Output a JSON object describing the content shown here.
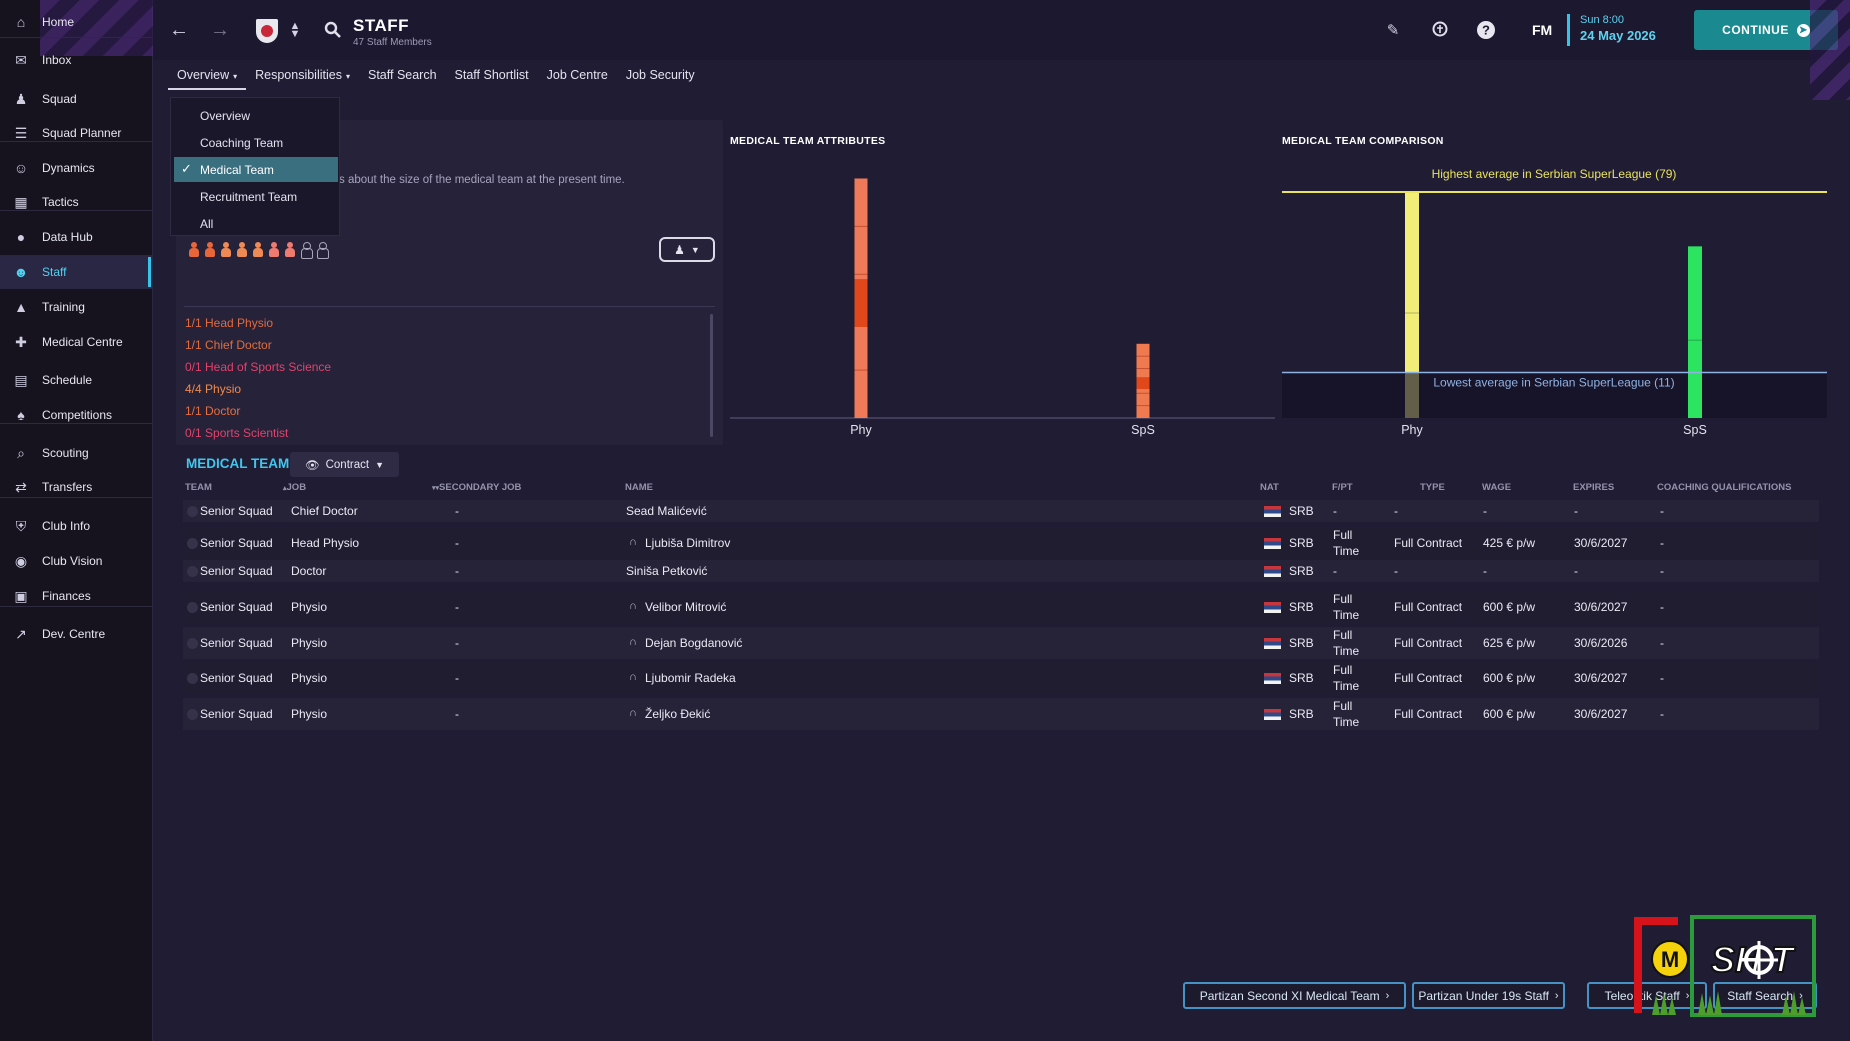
{
  "sidebar": {
    "items": [
      {
        "label": "Home",
        "icon": "home-icon"
      },
      {
        "label": "Inbox",
        "icon": "inbox-icon"
      },
      {
        "label": "Squad",
        "icon": "squad-icon"
      },
      {
        "label": "Squad Planner",
        "icon": "planner-icon"
      },
      {
        "label": "Dynamics",
        "icon": "dynamics-icon"
      },
      {
        "label": "Tactics",
        "icon": "tactics-icon"
      },
      {
        "label": "Data Hub",
        "icon": "data-hub-icon"
      },
      {
        "label": "Staff",
        "icon": "staff-icon"
      },
      {
        "label": "Training",
        "icon": "training-icon"
      },
      {
        "label": "Medical Centre",
        "icon": "medical-icon"
      },
      {
        "label": "Schedule",
        "icon": "calendar-icon"
      },
      {
        "label": "Competitions",
        "icon": "trophy-icon"
      },
      {
        "label": "Scouting",
        "icon": "scouting-icon"
      },
      {
        "label": "Transfers",
        "icon": "transfers-icon"
      },
      {
        "label": "Club Info",
        "icon": "shield-icon"
      },
      {
        "label": "Club Vision",
        "icon": "vision-icon"
      },
      {
        "label": "Finances",
        "icon": "finances-icon"
      },
      {
        "label": "Dev. Centre",
        "icon": "dev-centre-icon"
      }
    ],
    "active": "Staff"
  },
  "header": {
    "title": "STAFF",
    "subtitle": "47 Staff Members",
    "fm_label": "FM",
    "date_line1": "Sun 8:00",
    "date_line2": "24 May 2026",
    "continue_label": "CONTINUE"
  },
  "tabs": [
    {
      "label": "Overview",
      "dropdown": true,
      "active": true
    },
    {
      "label": "Responsibilities",
      "dropdown": true,
      "active": false
    },
    {
      "label": "Staff Search",
      "dropdown": false,
      "active": false
    },
    {
      "label": "Staff Shortlist",
      "dropdown": false,
      "active": false
    },
    {
      "label": "Job Centre",
      "dropdown": false,
      "active": false
    },
    {
      "label": "Job Security",
      "dropdown": false,
      "active": false
    }
  ],
  "dropdown": {
    "items": [
      "Overview",
      "Coaching Team",
      "Medical Team",
      "Recruitment Team",
      "All"
    ],
    "selected": "Medical Team"
  },
  "left_panel": {
    "description": "s about the size of the medical team at the present time.",
    "staff_icons": [
      {
        "filled": true,
        "color": "#e8673a"
      },
      {
        "filled": true,
        "color": "#e8673a"
      },
      {
        "filled": true,
        "color": "#ef8a55"
      },
      {
        "filled": true,
        "color": "#ef8a55"
      },
      {
        "filled": true,
        "color": "#ef8a55"
      },
      {
        "filled": true,
        "color": "#ef7a70"
      },
      {
        "filled": true,
        "color": "#ef7a70"
      },
      {
        "filled": false,
        "color": "#a8a6ba"
      },
      {
        "filled": false,
        "color": "#a8a6ba"
      }
    ],
    "requirements": [
      {
        "text": "1/1 Head Physio",
        "color": "#e36a3a"
      },
      {
        "text": "1/1 Chief Doctor",
        "color": "#e06e3c"
      },
      {
        "text": "0/1 Head of Sports Science",
        "color": "#e2436a"
      },
      {
        "text": "4/4 Physio",
        "color": "#f08a4a"
      },
      {
        "text": "1/1 Doctor",
        "color": "#e86e3c"
      },
      {
        "text": "0/1 Sports Scientist",
        "color": "#e2436a"
      }
    ]
  },
  "chart_data": [
    {
      "type": "bar",
      "title": "MEDICAL TEAM ATTRIBUTES",
      "categories": [
        "Phy",
        "SpS"
      ],
      "values": [
        71,
        22
      ],
      "segment_count": [
        5,
        6
      ],
      "colors": [
        "#ef7a5a",
        "#f07a50"
      ]
    },
    {
      "type": "bar",
      "title": "MEDICAL TEAM COMPARISON",
      "categories": [
        "Phy",
        "SpS"
      ],
      "values": [
        79,
        60
      ],
      "colors": [
        "#f2ec79",
        "#2ce460"
      ],
      "reference_lines": [
        {
          "label": "Highest average in Serbian SuperLeague (79)",
          "value": 79,
          "color": "#eae35c"
        },
        {
          "label": "Lowest average in Serbian SuperLeague (11)",
          "value": 11,
          "color": "#8fb2e3"
        }
      ]
    }
  ],
  "table": {
    "section_title": "MEDICAL TEAM",
    "contract_button": "Contract",
    "columns": [
      "TEAM",
      "JOB",
      "SECONDARY JOB",
      "NAME",
      "NAT",
      "F/PT",
      "TYPE",
      "WAGE",
      "EXPIRES",
      "COACHING QUALIFICATIONS"
    ],
    "rows": [
      {
        "team": "Senior Squad",
        "job": "Chief Doctor",
        "secondary": "-",
        "name": "Sead Malićević",
        "staff_icon": false,
        "nat": "SRB",
        "fpt1": "-",
        "fpt2": "",
        "type": "-",
        "wage": "-",
        "expires": "-",
        "quals": "-"
      },
      {
        "team": "Senior Squad",
        "job": "Head Physio",
        "secondary": "-",
        "name": "Ljubiša Dimitrov",
        "staff_icon": true,
        "nat": "SRB",
        "fpt1": "Full",
        "fpt2": "Time",
        "type": "Full Contract",
        "wage": "425 € p/w",
        "expires": "30/6/2027",
        "quals": "-"
      },
      {
        "team": "Senior Squad",
        "job": "Doctor",
        "secondary": "-",
        "name": "Siniša Petković",
        "staff_icon": false,
        "nat": "SRB",
        "fpt1": "-",
        "fpt2": "",
        "type": "-",
        "wage": "-",
        "expires": "-",
        "quals": "-"
      },
      {
        "team": "Senior Squad",
        "job": "Physio",
        "secondary": "-",
        "name": "Velibor Mitrović",
        "staff_icon": true,
        "nat": "SRB",
        "fpt1": "Full",
        "fpt2": "Time",
        "type": "Full Contract",
        "wage": "600 € p/w",
        "expires": "30/6/2027",
        "quals": "-"
      },
      {
        "team": "Senior Squad",
        "job": "Physio",
        "secondary": "-",
        "name": "Dejan Bogdanović",
        "staff_icon": true,
        "nat": "SRB",
        "fpt1": "Full",
        "fpt2": "Time",
        "type": "Full Contract",
        "wage": "625 € p/w",
        "expires": "30/6/2026",
        "quals": "-"
      },
      {
        "team": "Senior Squad",
        "job": "Physio",
        "secondary": "-",
        "name": "Ljubomir Radeka",
        "staff_icon": true,
        "nat": "SRB",
        "fpt1": "Full",
        "fpt2": "Time",
        "type": "Full Contract",
        "wage": "600 € p/w",
        "expires": "30/6/2027",
        "quals": "-"
      },
      {
        "team": "Senior Squad",
        "job": "Physio",
        "secondary": "-",
        "name": "Željko Đekić",
        "staff_icon": true,
        "nat": "SRB",
        "fpt1": "Full",
        "fpt2": "Time",
        "type": "Full Contract",
        "wage": "600 € p/w",
        "expires": "30/6/2027",
        "quals": "-"
      }
    ]
  },
  "bottom_links": [
    {
      "label": "Partizan Second XI Medical Team"
    },
    {
      "label": "Partizan Under 19s Staff"
    },
    {
      "label": "Teleoptik Staff"
    },
    {
      "label": "Staff Search"
    }
  ]
}
